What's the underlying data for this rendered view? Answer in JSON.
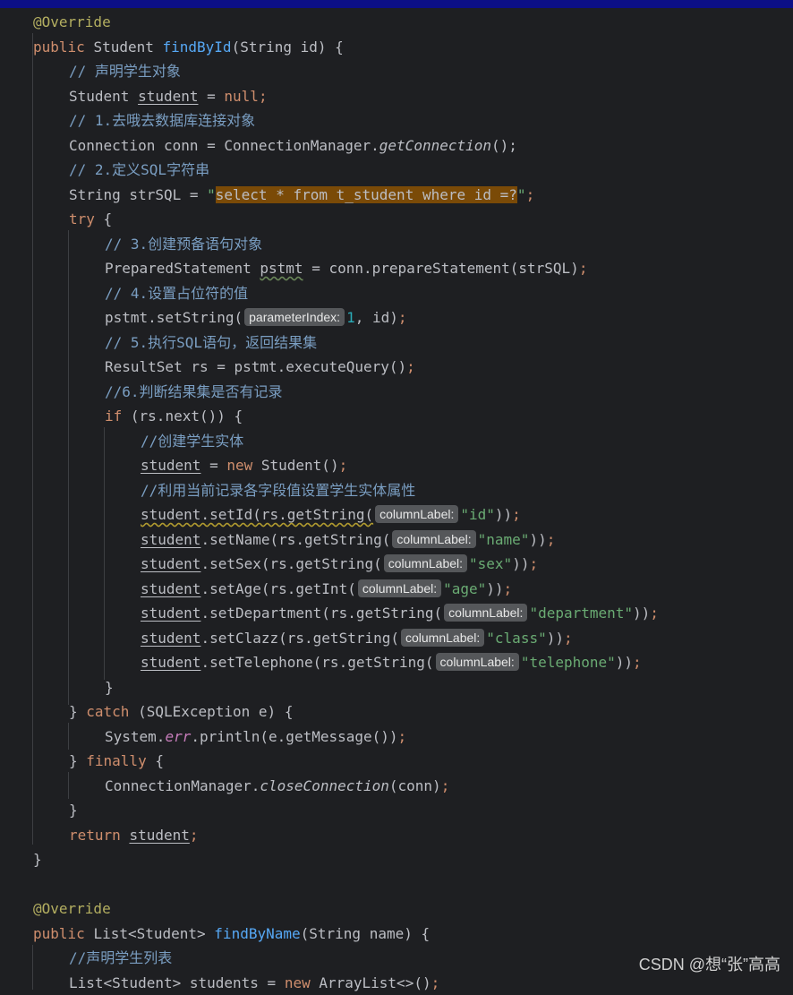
{
  "editor": {
    "lines": [
      [
        [
          "@Override",
          "ann"
        ]
      ],
      [
        [
          "public ",
          "kw"
        ],
        [
          "Student ",
          ""
        ],
        [
          "findById",
          "fn"
        ],
        [
          "(String id) {",
          ""
        ]
      ],
      [
        [
          "// 声明学生对象",
          "cmt"
        ]
      ],
      [
        [
          "Student ",
          ""
        ],
        [
          "student",
          "ul"
        ],
        [
          " = ",
          ""
        ],
        [
          "null",
          "kw"
        ],
        [
          ";",
          "kw"
        ]
      ],
      [
        [
          "// 1.去哦去数据库连接对象",
          "cmt"
        ]
      ],
      [
        [
          "Connection conn = ConnectionManager.",
          ""
        ],
        [
          "getConnection",
          "st"
        ],
        [
          "();",
          ""
        ]
      ],
      [
        [
          "// 2.定义SQL字符串",
          "cmt"
        ]
      ],
      [
        [
          "String strSQL = ",
          ""
        ],
        [
          "\"",
          "str"
        ],
        [
          "select * from t_student where id =?",
          "hl"
        ],
        [
          "\"",
          "str"
        ],
        [
          ";",
          "kw"
        ]
      ],
      [
        [
          "try ",
          "kw"
        ],
        [
          "{",
          ""
        ]
      ],
      [
        [
          "// 3.创建预备语句对象",
          "cmt"
        ]
      ],
      [
        [
          "PreparedStatement ",
          ""
        ],
        [
          "pstmt",
          "wavy"
        ],
        [
          " = conn.prepareStatement(strSQL)",
          ""
        ],
        [
          ";",
          "kw"
        ]
      ],
      [
        [
          "// 4.设置占位符的值",
          "cmt"
        ]
      ],
      [
        [
          "pstmt.setString(",
          ""
        ],
        [
          "parameterIndex:",
          "hint"
        ],
        [
          "1",
          "num"
        ],
        [
          ", id)",
          ""
        ],
        [
          ";",
          "kw"
        ]
      ],
      [
        [
          "// 5.执行SQL语句，返回结果集",
          "cmt"
        ]
      ],
      [
        [
          "ResultSet rs = pstmt.executeQuery()",
          ""
        ],
        [
          ";",
          "kw"
        ]
      ],
      [
        [
          "//6.判断结果集是否有记录",
          "cmt"
        ]
      ],
      [
        [
          "if ",
          "kw"
        ],
        [
          "(rs.next()) {",
          ""
        ]
      ],
      [
        [
          "//创建学生实体",
          "cmt"
        ]
      ],
      [
        [
          "student",
          "ul"
        ],
        [
          " = ",
          ""
        ],
        [
          "new ",
          "kw"
        ],
        [
          "Student()",
          ""
        ],
        [
          ";",
          "kw"
        ]
      ],
      [
        [
          "//利用当前记录各字段值设置学生实体属性",
          "cmt"
        ]
      ],
      [
        [
          "student.setId(rs.getString(",
          "wavyy"
        ],
        [
          "columnLabel:",
          "hint"
        ],
        [
          "\"id\"",
          "str"
        ],
        [
          "))",
          ""
        ],
        [
          ";",
          "kw"
        ]
      ],
      [
        [
          "student",
          "ul"
        ],
        [
          ".setName(rs.getString(",
          ""
        ],
        [
          "columnLabel:",
          "hint"
        ],
        [
          "\"name\"",
          "str"
        ],
        [
          "))",
          ""
        ],
        [
          ";",
          "kw"
        ]
      ],
      [
        [
          "student",
          "ul"
        ],
        [
          ".setSex(rs.getString(",
          ""
        ],
        [
          "columnLabel:",
          "hint"
        ],
        [
          "\"sex\"",
          "str"
        ],
        [
          "))",
          ""
        ],
        [
          ";",
          "kw"
        ]
      ],
      [
        [
          "student",
          "ul"
        ],
        [
          ".setAge(rs.getInt(",
          ""
        ],
        [
          "columnLabel:",
          "hint"
        ],
        [
          "\"age\"",
          "str"
        ],
        [
          "))",
          ""
        ],
        [
          ";",
          "kw"
        ]
      ],
      [
        [
          "student",
          "ul"
        ],
        [
          ".setDepartment(rs.getString(",
          ""
        ],
        [
          "columnLabel:",
          "hint"
        ],
        [
          "\"department\"",
          "str"
        ],
        [
          "))",
          ""
        ],
        [
          ";",
          "kw"
        ]
      ],
      [
        [
          "student",
          "ul"
        ],
        [
          ".setClazz(rs.getString(",
          ""
        ],
        [
          "columnLabel:",
          "hint"
        ],
        [
          "\"class\"",
          "str"
        ],
        [
          "))",
          ""
        ],
        [
          ";",
          "kw"
        ]
      ],
      [
        [
          "student",
          "ul"
        ],
        [
          ".setTelephone(rs.getString(",
          ""
        ],
        [
          "columnLabel:",
          "hint"
        ],
        [
          "\"telephone\"",
          "str"
        ],
        [
          "))",
          ""
        ],
        [
          ";",
          "kw"
        ]
      ],
      [
        [
          "}",
          ""
        ]
      ],
      [
        [
          "} ",
          ""
        ],
        [
          "catch ",
          "kw"
        ],
        [
          "(SQLException e) {",
          ""
        ]
      ],
      [
        [
          "System.",
          ""
        ],
        [
          "err",
          "stf"
        ],
        [
          ".println(e.getMessage())",
          ""
        ],
        [
          ";",
          "kw"
        ]
      ],
      [
        [
          "} ",
          ""
        ],
        [
          "finally ",
          "kw"
        ],
        [
          "{",
          ""
        ]
      ],
      [
        [
          "ConnectionManager.",
          ""
        ],
        [
          "closeConnection",
          "st"
        ],
        [
          "(conn)",
          ""
        ],
        [
          ";",
          "kw"
        ]
      ],
      [
        [
          "}",
          ""
        ]
      ],
      [
        [
          "return ",
          "kw"
        ],
        [
          "student",
          "ul"
        ],
        [
          ";",
          "kw"
        ]
      ],
      [
        [
          "}",
          ""
        ]
      ],
      [],
      [
        [
          "@Override",
          "ann"
        ]
      ],
      [
        [
          "public ",
          "kw"
        ],
        [
          "List<Student> ",
          ""
        ],
        [
          "findByName",
          "fn"
        ],
        [
          "(String name) {",
          ""
        ]
      ],
      [
        [
          "//声明学生列表",
          "cmt"
        ]
      ],
      [
        [
          "List<Student> students = ",
          ""
        ],
        [
          "new ",
          "kw"
        ],
        [
          "ArrayList<>()",
          ""
        ],
        [
          ";",
          "kw"
        ]
      ]
    ]
  },
  "watermark": "CSDN @想“张”高高"
}
